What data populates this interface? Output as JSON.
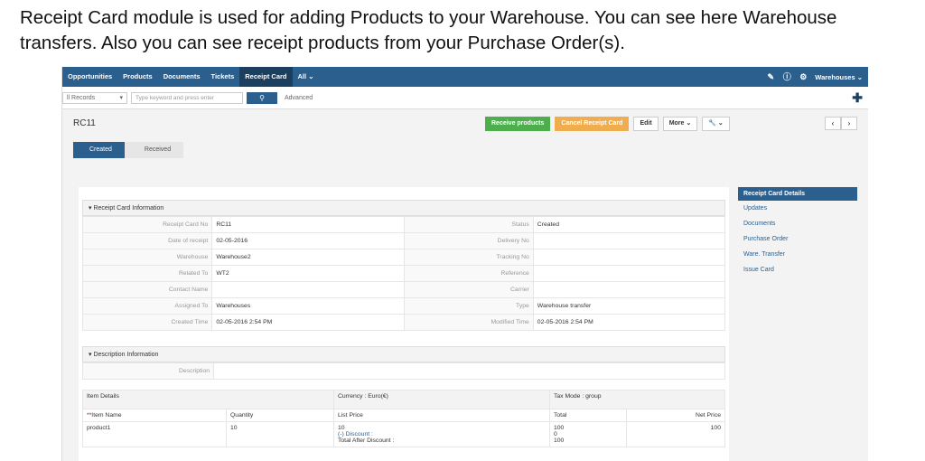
{
  "caption": "Receipt Card module is used for adding Products to your Warehouse. You can see here Warehouse transfers. Also you can see receipt products from your Purchase Order(s).",
  "nav": {
    "items": [
      "Opportunities",
      "Products",
      "Documents",
      "Tickets",
      "Receipt Card",
      "All"
    ],
    "active": "Receipt Card",
    "user": "Warehouses"
  },
  "search": {
    "filter": "ll Records",
    "placeholder": "Type keyword and press enter",
    "advanced": "Advanced"
  },
  "record": {
    "title": "RC11",
    "buttons": {
      "receive": "Receive products",
      "cancel": "Cancel Receipt Card",
      "edit": "Edit",
      "more": "More"
    },
    "steps": [
      "Created",
      "Received"
    ]
  },
  "info": {
    "section": "Receipt Card Information",
    "rows": [
      {
        "l1": "Receipt Card No",
        "v1": "RC11",
        "l2": "Status",
        "v2": "Created"
      },
      {
        "l1": "Date of receipt",
        "v1": "02-05-2016",
        "l2": "Delivery No",
        "v2": ""
      },
      {
        "l1": "Warehouse",
        "v1": "Warehouse2",
        "l2": "Tracking No",
        "v2": ""
      },
      {
        "l1": "Related To",
        "v1": "WT2",
        "l2": "Reference",
        "v2": ""
      },
      {
        "l1": "Contact Name",
        "v1": "",
        "l2": "Carrier",
        "v2": ""
      },
      {
        "l1": "Assigned To",
        "v1": "Warehouses",
        "l2": "Type",
        "v2": "Warehouse transfer"
      },
      {
        "l1": "Created Time",
        "v1": "02-05-2016 2:54 PM",
        "l2": "Modified Time",
        "v2": "02-05-2016 2:54 PM"
      }
    ]
  },
  "description": {
    "section": "Description Information",
    "label": "Description",
    "value": ""
  },
  "items": {
    "details": "Item Details",
    "currency": "Currency : Euro(€)",
    "taxmode": "Tax Mode : group",
    "columns": [
      "*Item Name",
      "Quantity",
      "List Price",
      "Total",
      "Net Price"
    ],
    "row": {
      "name": "product1",
      "qty": "10",
      "list_price": "10",
      "discount_label": "(-)  Discount :",
      "after_discount_label": "Total After Discount :",
      "total": "100",
      "discount": "0",
      "after_discount": "100",
      "net": "100"
    }
  },
  "sidepanel": {
    "header": "Receipt Card Details",
    "items": [
      "Updates",
      "Documents",
      "Purchase Order",
      "Ware. Transfer",
      "Issue Card"
    ]
  }
}
